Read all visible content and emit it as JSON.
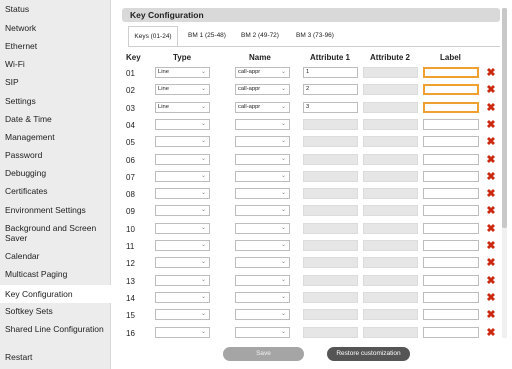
{
  "sidebar": {
    "items": [
      {
        "label": "Status"
      },
      {
        "label": "Network"
      },
      {
        "label": "Ethernet"
      },
      {
        "label": "Wi-Fi"
      },
      {
        "label": "SIP"
      },
      {
        "label": "Settings"
      },
      {
        "label": "Date & Time"
      },
      {
        "label": "Management"
      },
      {
        "label": "Password"
      },
      {
        "label": "Debugging"
      },
      {
        "label": "Certificates"
      },
      {
        "label": "Environment Settings"
      },
      {
        "label": "Background and Screen Saver"
      },
      {
        "label": "Calendar"
      },
      {
        "label": "Multicast Paging"
      },
      {
        "label": "Key Configuration"
      },
      {
        "label": "Softkey Sets"
      },
      {
        "label": "Shared Line Configuration"
      },
      {
        "label": "Restart"
      }
    ],
    "active": "Key Configuration"
  },
  "panel": {
    "title": "Key Configuration"
  },
  "tabs": [
    {
      "label": "Keys (01-24)"
    },
    {
      "label": "BM 1 (25-48)"
    },
    {
      "label": "BM 2 (49-72)"
    },
    {
      "label": "BM 3 (73-96)"
    }
  ],
  "columns": {
    "key": "Key",
    "type": "Type",
    "name": "Name",
    "attr1": "Attribute 1",
    "attr2": "Attribute 2",
    "label": "Label"
  },
  "rows": [
    {
      "key": "01",
      "type": "Line",
      "name": "call-appr",
      "attr1": "1",
      "attr2": "",
      "label": ""
    },
    {
      "key": "02",
      "type": "Line",
      "name": "call-appr",
      "attr1": "2",
      "attr2": "",
      "label": ""
    },
    {
      "key": "03",
      "type": "Line",
      "name": "call-appr",
      "attr1": "3",
      "attr2": "",
      "label": ""
    },
    {
      "key": "04",
      "type": "",
      "name": "",
      "attr1": "",
      "attr2": "",
      "label": ""
    },
    {
      "key": "05",
      "type": "",
      "name": "",
      "attr1": "",
      "attr2": "",
      "label": ""
    },
    {
      "key": "06",
      "type": "",
      "name": "",
      "attr1": "",
      "attr2": "",
      "label": ""
    },
    {
      "key": "07",
      "type": "",
      "name": "",
      "attr1": "",
      "attr2": "",
      "label": ""
    },
    {
      "key": "08",
      "type": "",
      "name": "",
      "attr1": "",
      "attr2": "",
      "label": ""
    },
    {
      "key": "09",
      "type": "",
      "name": "",
      "attr1": "",
      "attr2": "",
      "label": ""
    },
    {
      "key": "10",
      "type": "",
      "name": "",
      "attr1": "",
      "attr2": "",
      "label": ""
    },
    {
      "key": "11",
      "type": "",
      "name": "",
      "attr1": "",
      "attr2": "",
      "label": ""
    },
    {
      "key": "12",
      "type": "",
      "name": "",
      "attr1": "",
      "attr2": "",
      "label": ""
    },
    {
      "key": "13",
      "type": "",
      "name": "",
      "attr1": "",
      "attr2": "",
      "label": ""
    },
    {
      "key": "14",
      "type": "",
      "name": "",
      "attr1": "",
      "attr2": "",
      "label": ""
    },
    {
      "key": "15",
      "type": "",
      "name": "",
      "attr1": "",
      "attr2": "",
      "label": ""
    },
    {
      "key": "16",
      "type": "",
      "name": "",
      "attr1": "",
      "attr2": "",
      "label": ""
    }
  ],
  "buttons": {
    "save": "Save",
    "restore": "Restore customization"
  },
  "colors": {
    "delete_icon": "#cc2a10",
    "focus_outline": "#f0a030",
    "restore_button": "#555555",
    "save_button_disabled": "#a5a5a5"
  },
  "icons": {
    "delete": "close-x-icon",
    "dropdown": "chevron-down-icon"
  }
}
